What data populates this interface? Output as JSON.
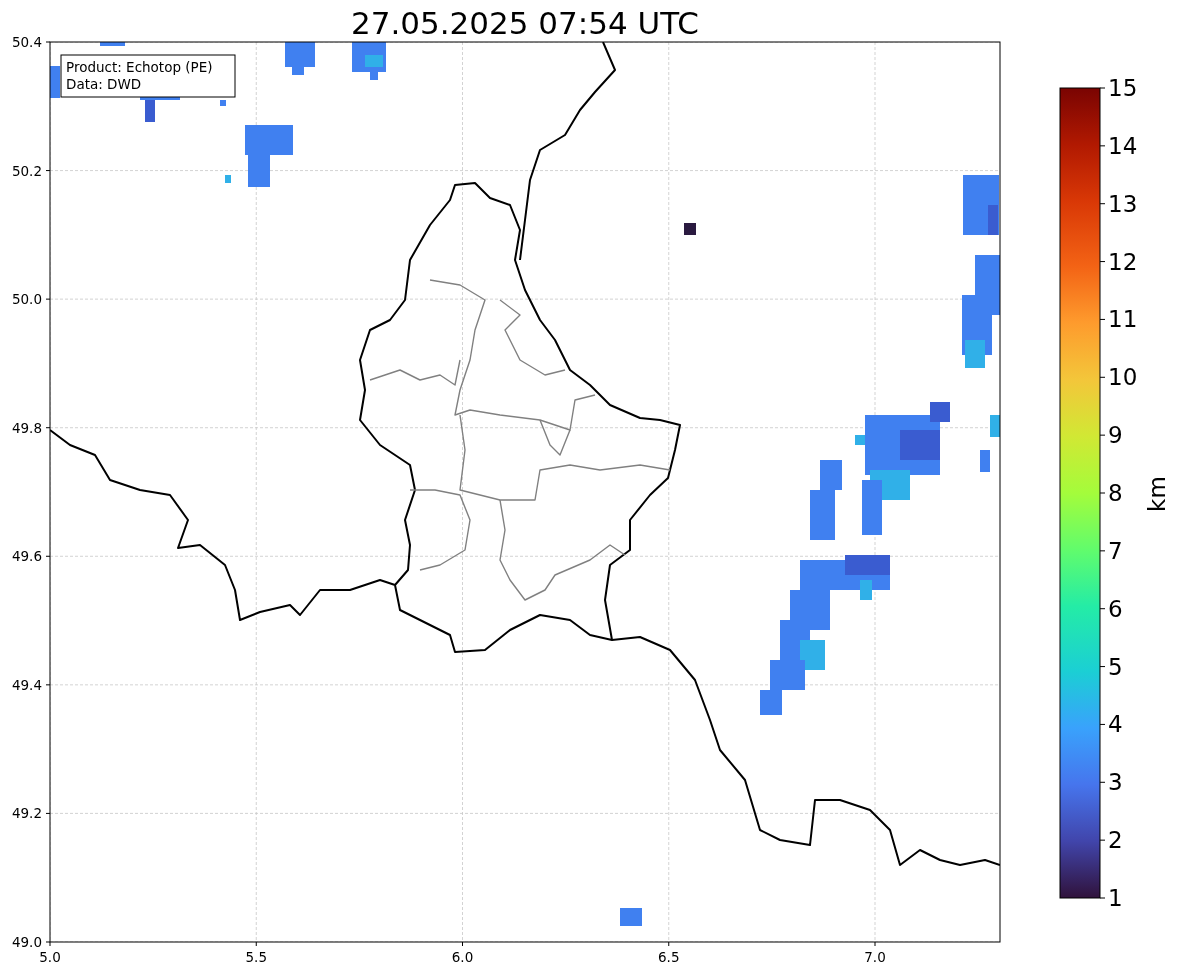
{
  "title": "27.05.2025 07:54 UTC",
  "legend": [
    "Product: Echotop (PE)",
    "Data: DWD"
  ],
  "x_axis": {
    "ticks": [
      "5.0",
      "5.5",
      "6.0",
      "6.5",
      "7.0"
    ]
  },
  "y_axis": {
    "ticks": [
      "50.4",
      "50.2",
      "50.0",
      "49.8",
      "49.6",
      "49.4",
      "49.2",
      "49.0"
    ]
  },
  "colorbar": {
    "label": "km",
    "ticks": [
      "15",
      "14",
      "13",
      "12",
      "11",
      "10",
      "9",
      "8",
      "7",
      "6",
      "5",
      "4",
      "3",
      "2",
      "1"
    ]
  }
}
